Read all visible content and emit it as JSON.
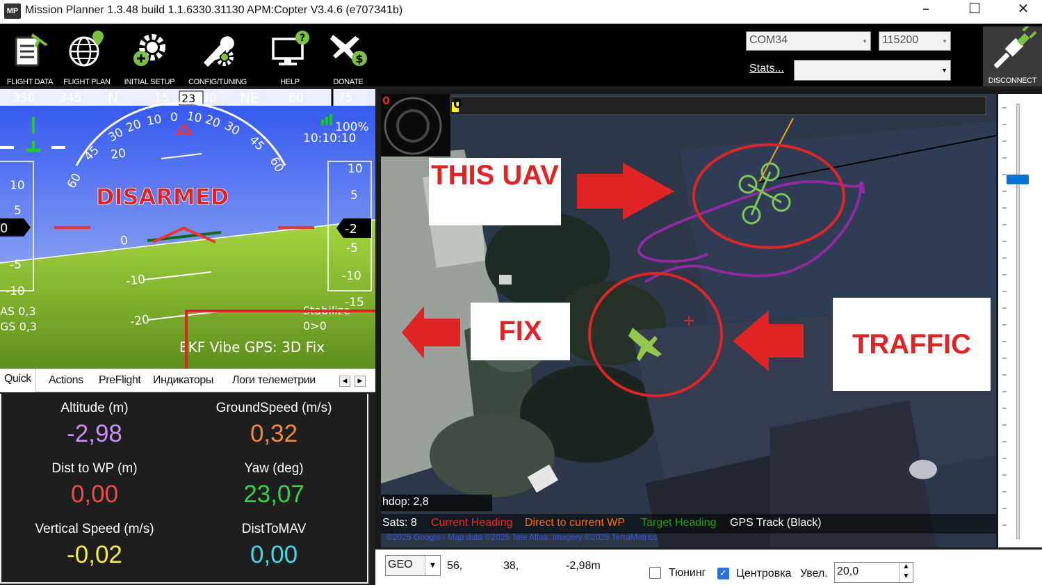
{
  "window": {
    "logo": "MP",
    "title": "Mission Planner 1.3.48 build 1.1.6330.31130 APM:Copter V3.4.6 (e707341b)",
    "minimize": "–",
    "maximize": "☐",
    "close": "✕"
  },
  "toolbar": {
    "items": [
      {
        "label": "FLIGHT DATA",
        "icon": "clipboard-plane-icon"
      },
      {
        "label": "FLIGHT PLAN",
        "icon": "globe-pin-icon"
      },
      {
        "label": "INITIAL SETUP",
        "icon": "gear-plus-icon"
      },
      {
        "label": "CONFIG/TUNING",
        "icon": "wrench-gear-icon"
      },
      {
        "label": "HELP",
        "icon": "monitor-question-icon"
      },
      {
        "label": "DONATE",
        "icon": "plane-dollar-icon"
      }
    ],
    "port": "COM34",
    "baud": "115200",
    "stats_label": "Stats...",
    "stats_value": "",
    "disconnect_label": "DISCONNECT"
  },
  "hud": {
    "heading_tape": [
      "330",
      "345",
      "N",
      "15",
      "30",
      "NE",
      "60",
      "75"
    ],
    "heading_value": "23",
    "battery_percent": "100%",
    "time": "10:10:10",
    "status": "DISARMED",
    "airspeed_label": "AS 0,3",
    "groundspeed_label": "GS 0,3",
    "altitude_value": "-2",
    "speed_value": "0",
    "mode": "Stabilize",
    "wp_info": "0>0",
    "bottom_status": "EKF  Vibe  GPS: 3D Fix",
    "left_tape": [
      "10",
      "5",
      "-5",
      "-10"
    ],
    "right_tape": [
      "10",
      "5",
      "-5",
      "-10",
      "-15"
    ],
    "pitch_labels": [
      "20",
      "0",
      "-10",
      "-20"
    ],
    "roll_labels": [
      "60",
      "45",
      "30",
      "20",
      "10",
      "0",
      "10",
      "20",
      "30",
      "45",
      "60"
    ]
  },
  "tabs": {
    "items": [
      "Quick",
      "Actions",
      "PreFlight",
      "Индикаторы",
      "Логи телеметрии"
    ],
    "active": "Quick",
    "scroll_left": "◀",
    "scroll_right": "▶"
  },
  "quick": [
    {
      "label": "Altitude (m)",
      "value": "-2,98",
      "color": "#c98ef5"
    },
    {
      "label": "GroundSpeed (m/s)",
      "value": "0,32",
      "color": "#f08a3a"
    },
    {
      "label": "Dist to WP (m)",
      "value": "0,00",
      "color": "#ef4b4b"
    },
    {
      "label": "Yaw (deg)",
      "value": "23,07",
      "color": "#34d24b"
    },
    {
      "label": "Vertical Speed (m/s)",
      "value": "-0,02",
      "color": "#f3ef3c"
    },
    {
      "label": "DistToMAV",
      "value": "0,00",
      "color": "#3fd9e6"
    }
  ],
  "map": {
    "top_left_counter": "0",
    "progress_value": "0",
    "hdop": "hdop: 2,8",
    "sats": "Sats: 8",
    "legend": [
      {
        "label": "Current Heading",
        "color": "#ff2020"
      },
      {
        "label": "Direct to current WP",
        "color": "#ff6a00"
      },
      {
        "label": "Target Heading",
        "color": "#18a018"
      },
      {
        "label": "GPS Track (Black)",
        "color": "#ffffff"
      }
    ],
    "copyright": "©2025 Google - Map data ©2025 Tele Atlas, Imagery ©2025 TerraMetrics"
  },
  "annotations": {
    "this_uav": "THIS UAV",
    "fix": "FIX",
    "traffic": "TRAFFIC"
  },
  "bottom_bar": {
    "coord_system": "GEO",
    "lat": "56,",
    "lng": "38,",
    "alt": "-2,98m",
    "tuning_label": "Тюнинг",
    "tuning_checked": false,
    "center_label": "Центровка",
    "center_checked": true,
    "zoom_label": "Увел.",
    "zoom_value": "20,0"
  }
}
